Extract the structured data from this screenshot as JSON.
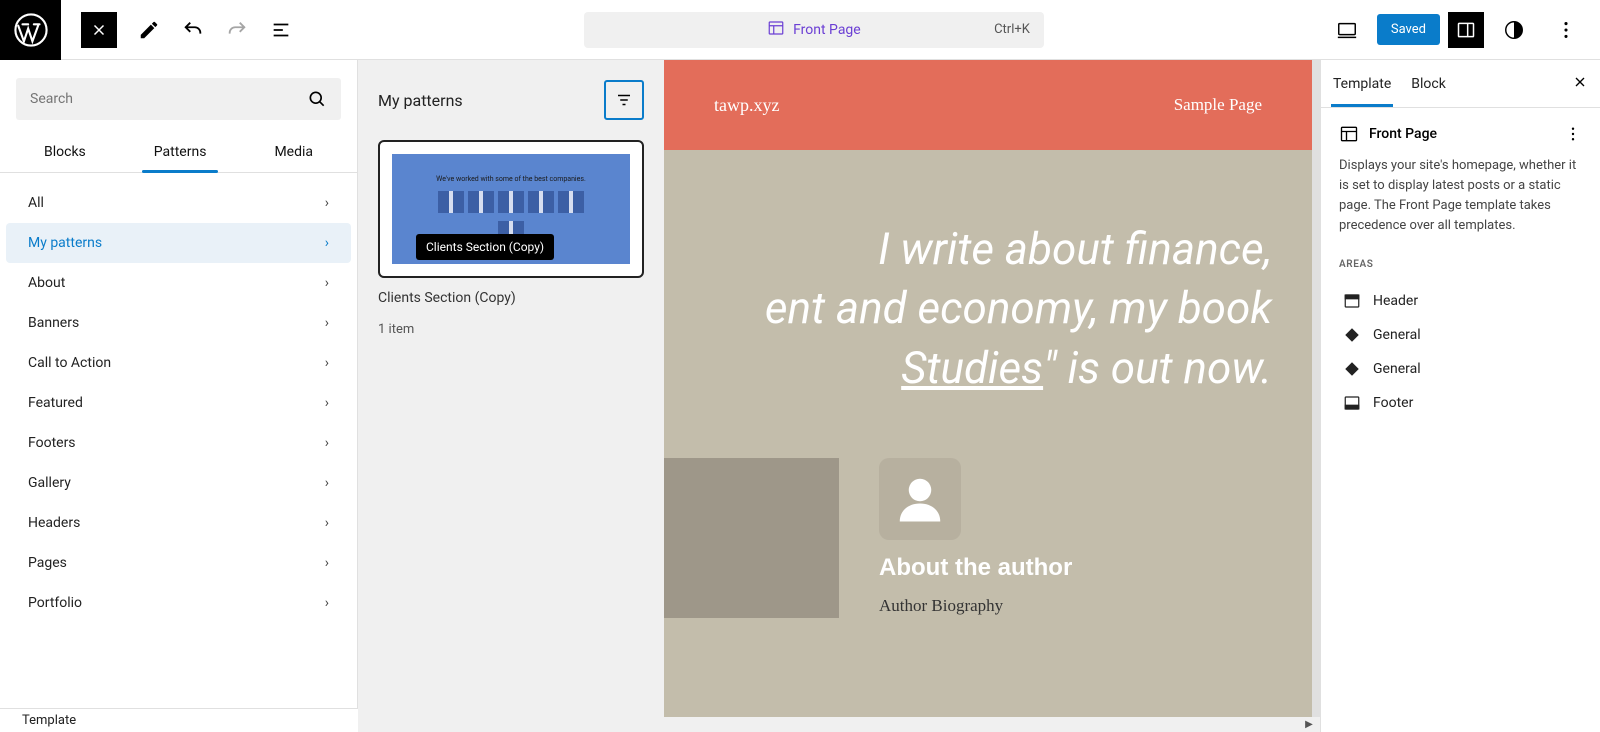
{
  "topbar": {
    "breadcrumb_title": "Front Page",
    "shortcut": "Ctrl+K",
    "saved_label": "Saved"
  },
  "inserter": {
    "search_placeholder": "Search",
    "tabs": {
      "blocks": "Blocks",
      "patterns": "Patterns",
      "media": "Media"
    },
    "categories": [
      {
        "label": "All",
        "key": "all"
      },
      {
        "label": "My patterns",
        "key": "my-patterns",
        "active": true
      },
      {
        "label": "About",
        "key": "about"
      },
      {
        "label": "Banners",
        "key": "banners"
      },
      {
        "label": "Call to Action",
        "key": "cta"
      },
      {
        "label": "Featured",
        "key": "featured"
      },
      {
        "label": "Footers",
        "key": "footers"
      },
      {
        "label": "Gallery",
        "key": "gallery"
      },
      {
        "label": "Headers",
        "key": "headers"
      },
      {
        "label": "Pages",
        "key": "pages"
      },
      {
        "label": "Portfolio",
        "key": "portfolio"
      }
    ]
  },
  "patterns_panel": {
    "title": "My patterns",
    "preview_caption": "We've worked with some of the best companies.",
    "card_label": "Clients Section (Copy)",
    "tooltip": "Clients Section (Copy)",
    "count": "1 item"
  },
  "canvas": {
    "site_url": "tawp.xyz",
    "nav_item": "Sample Page",
    "hero_line1": "I write about finance,",
    "hero_line2": "ent and economy, my book",
    "hero_line3a": "Studies",
    "hero_line3b": "\" is out now.",
    "author_heading": "About the author",
    "author_bio": "Author Biography"
  },
  "right_panel": {
    "tabs": {
      "template": "Template",
      "block": "Block"
    },
    "title": "Front Page",
    "description": "Displays your site's homepage, whether it is set to display latest posts or a static page. The Front Page template takes precedence over all templates.",
    "areas_heading": "AREAS",
    "areas": [
      {
        "label": "Header",
        "icon": "header"
      },
      {
        "label": "General",
        "icon": "diamond"
      },
      {
        "label": "General",
        "icon": "diamond"
      },
      {
        "label": "Footer",
        "icon": "footer"
      }
    ]
  },
  "bottom_crumb": "Template"
}
